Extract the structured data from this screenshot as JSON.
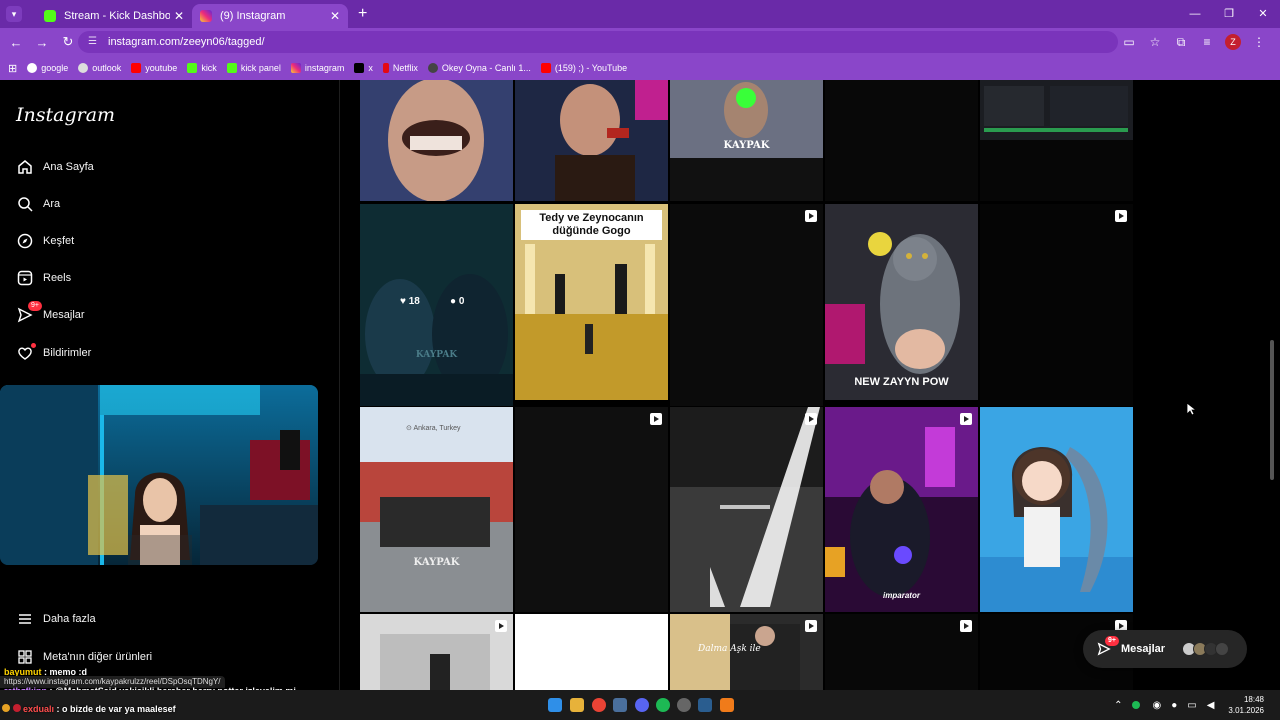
{
  "browser": {
    "tabs": [
      {
        "title": "Stream - Kick Dashboard",
        "active": false
      },
      {
        "title": "(9) Instagram",
        "active": true
      }
    ],
    "url": "instagram.com/zeeyn06/tagged/",
    "profile_initial": "Z",
    "bookmarks": [
      "google",
      "outlook",
      "youtube",
      "kick",
      "kick panel",
      "instagram",
      "x",
      "Netflix",
      "Okey Oyna - Canlı 1...",
      "(159) ;) - YouTube"
    ]
  },
  "sidebar": {
    "logo": "Instagram",
    "items": [
      {
        "label": "Ana Sayfa",
        "icon": "home-icon"
      },
      {
        "label": "Ara",
        "icon": "search-icon"
      },
      {
        "label": "Keşfet",
        "icon": "compass-icon"
      },
      {
        "label": "Reels",
        "icon": "reels-icon"
      },
      {
        "label": "Mesajlar",
        "icon": "messenger-icon",
        "badge": "9+"
      },
      {
        "label": "Bildirimler",
        "icon": "heart-icon"
      }
    ],
    "more": "Daha fazla",
    "meta": "Meta'nın diğer ürünleri"
  },
  "posts": {
    "kaypak_1": "KAYPAK",
    "likes": "18",
    "comments": "0",
    "kaypak_2": "KAYPAK",
    "wedding_caption": "Tedy ve Zeynocanın düğünde Gogo",
    "cat_caption": "NEW ZAYYN POW",
    "location": "Ankara, Turkey",
    "kaypak_3": "KAYPAK",
    "imparator": "imparator",
    "wedding_sign": "Dalma Aşk ile"
  },
  "messages_bubble": {
    "label": "Mesajlar",
    "badge": "9+"
  },
  "status_url": "https://www.instagram.com/kaypakrulzz/reel/DSpOsqTDNgY/",
  "chat": [
    {
      "user": "bayumut",
      "text": "memo :d"
    },
    {
      "user": "rethzfkinn",
      "text": "@MehmetSaid yakisikli beraber harry potter izleyelim mi"
    },
    {
      "user": "exdualı",
      "text": "o bizde de var ya maalesef"
    }
  ],
  "taskbar": {
    "time": "18:48",
    "date": "3.01.2026"
  }
}
